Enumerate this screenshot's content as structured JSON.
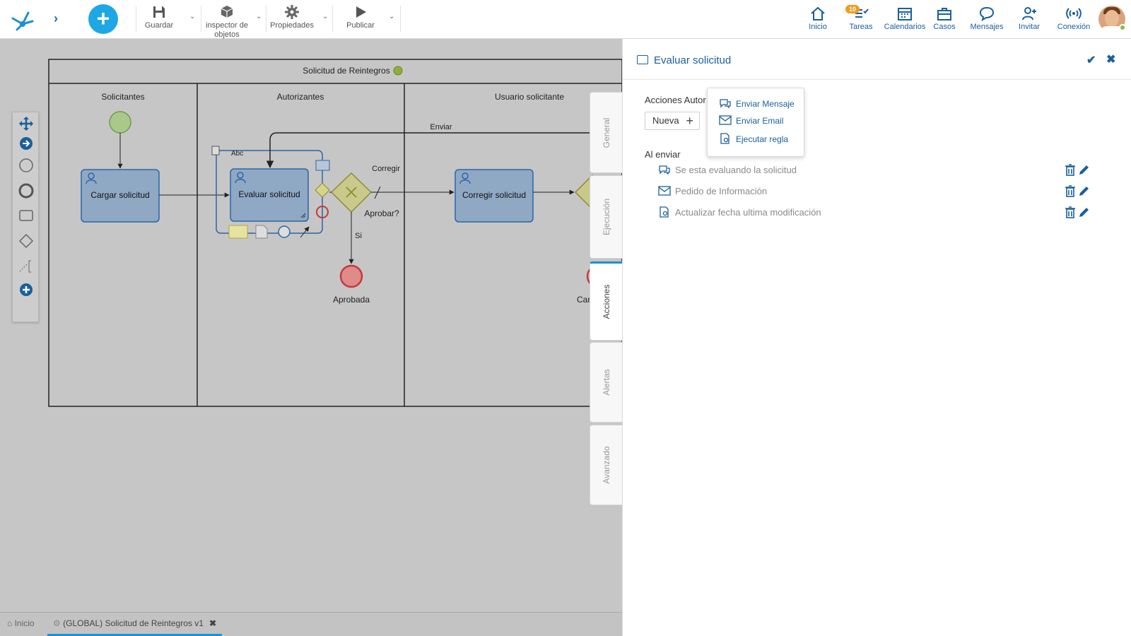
{
  "toolbar": {
    "save": "Guardar",
    "inspector_line1": "inspector de",
    "inspector_line2": "objetos",
    "properties": "Propiedades",
    "publish": "Publicar"
  },
  "right_nav": {
    "home": "Inicio",
    "tasks": "Tareas",
    "tasks_badge": "10",
    "calendars": "Calendarios",
    "cases": "Casos",
    "messages": "Mensajes",
    "invite": "Invitar",
    "connection": "Conexión"
  },
  "diagram": {
    "pool_title": "Solicitud de Reintegros",
    "lanes": [
      "Solicitantes",
      "Autorizantes",
      "Usuario solicitante"
    ],
    "tasks": {
      "cargar": "Cargar solicitud",
      "evaluar": "Evaluar solicitud",
      "corregir": "Corregir solicitud"
    },
    "gateway_label": "Aprobar?",
    "flow_labels": {
      "enviar": "Enviar",
      "corregir": "Corregir",
      "si": "Si"
    },
    "end_event_label": "Aprobada",
    "truncated_label": "Car",
    "text_tool": "Abc"
  },
  "side_tabs": [
    "General",
    "Ejecución",
    "Acciones",
    "Alertas",
    "Avanzado"
  ],
  "panel": {
    "title": "Evaluar solicitud",
    "acciones_label": "Acciones Autor",
    "nueva_button": "Nueva",
    "al_enviar_label": "Al enviar",
    "actions": [
      {
        "icon": "message-icon",
        "text": "Se esta evaluando la solicitud"
      },
      {
        "icon": "email-icon",
        "text": "Pedido de Información"
      },
      {
        "icon": "rule-icon",
        "text": "Actualizar fecha ultima modificación"
      }
    ]
  },
  "popup_menu": {
    "items": [
      "Enviar Mensaje",
      "Enviar Email",
      "Ejecutar regla"
    ]
  },
  "bottom_tabs": {
    "home": "Inicio",
    "document": "(GLOBAL) Solicitud de Reintegros v1"
  },
  "colors": {
    "accent": "#1e8fd3",
    "link": "#1a5f9c",
    "task_fill": "#8fa8c4",
    "gateway_fill": "#c9c98a",
    "start_event": "#a9c98a",
    "end_event": "#e08a8a"
  }
}
